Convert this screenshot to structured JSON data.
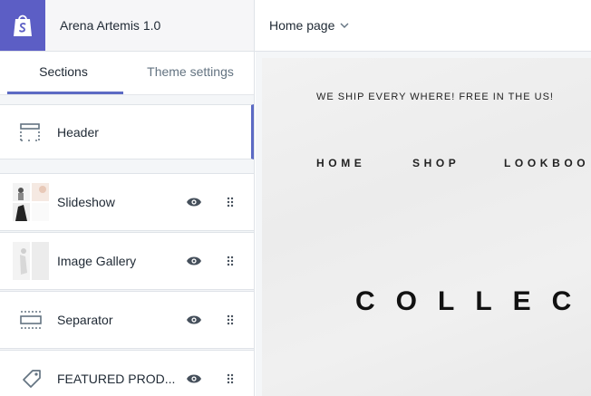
{
  "topbar": {
    "theme_name": "Arena Artemis 1.0",
    "page_select": "Home page",
    "logo_icon": "shopify-bag-icon",
    "chevron_icon": "chevron-down-icon"
  },
  "sidebar": {
    "tabs": [
      {
        "label": "Sections",
        "active": true
      },
      {
        "label": "Theme settings",
        "active": false
      }
    ],
    "header_item": {
      "label": "Header",
      "icon": "header-layout-icon"
    },
    "items": [
      {
        "label": "Slideshow",
        "icon": "slideshow-thumbnail"
      },
      {
        "label": "Image Gallery",
        "icon": "gallery-thumbnail"
      },
      {
        "label": "Separator",
        "icon": "separator-layout-icon"
      },
      {
        "label": "FEATURED PROD...",
        "icon": "tag-icon"
      }
    ]
  },
  "preview": {
    "ship_message": "WE SHIP EVERY WHERE! FREE IN THE US!",
    "nav": [
      "HOME",
      "SHOP",
      "LOOKBOO"
    ],
    "hero_text": "COLLEC"
  },
  "colors": {
    "accent": "#5c6ac4",
    "logo_bg": "#5c5ec5",
    "sidebar_bg": "#f4f6f8"
  }
}
